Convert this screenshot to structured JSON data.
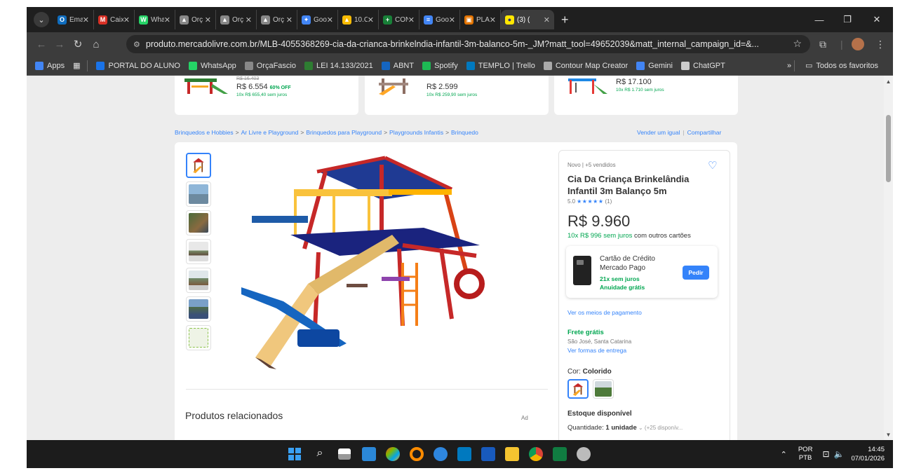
{
  "tabs": [
    {
      "label": "Ema",
      "icon": "outlook-icon",
      "color": "#0f6cbd",
      "glyph": "O"
    },
    {
      "label": "Caix",
      "icon": "gmail-icon",
      "color": "#d93025",
      "glyph": "M"
    },
    {
      "label": "Wha",
      "icon": "whatsapp-icon",
      "color": "#25d366",
      "glyph": "W"
    },
    {
      "label": "Orç",
      "icon": "orcafascio-icon",
      "color": "#888888",
      "glyph": "▲"
    },
    {
      "label": "Orç",
      "icon": "orcafascio-icon",
      "color": "#888888",
      "glyph": "▲"
    },
    {
      "label": "Orç",
      "icon": "orcafascio-icon",
      "color": "#888888",
      "glyph": "▲"
    },
    {
      "label": "Goo",
      "icon": "gemini-icon",
      "color": "#4285f4",
      "glyph": "✦"
    },
    {
      "label": "10.C",
      "icon": "drive-icon",
      "color": "#fbbc04",
      "glyph": "▲"
    },
    {
      "label": "CON",
      "icon": "sheets-icon",
      "color": "#188038",
      "glyph": "+"
    },
    {
      "label": "Goo",
      "icon": "docs-icon",
      "color": "#4285f4",
      "glyph": "≡"
    },
    {
      "label": "PLA",
      "icon": "calendar-icon",
      "color": "#e37400",
      "glyph": "▣"
    }
  ],
  "active_tab": {
    "label": "(3) (",
    "icon": "mercadolivre-icon",
    "color": "#ffe600"
  },
  "address": {
    "url": "produto.mercadolivre.com.br/MLB-4055368269-cia-da-crianca-brinkelndia-infantil-3m-balanco-5m-_JM?matt_tool=49652039&matt_internal_campaign_id=&..."
  },
  "bookmarks": [
    {
      "label": "Apps",
      "icon": "apps-grid-icon",
      "color": "#4285f4"
    },
    {
      "label": "PORTAL DO ALUNO",
      "icon": "portal-icon",
      "color": "#1a73e8"
    },
    {
      "label": "WhatsApp",
      "icon": "whatsapp-icon",
      "color": "#25d366"
    },
    {
      "label": "OrçaFascio",
      "icon": "orcafascio-icon",
      "color": "#888888"
    },
    {
      "label": "LEI 14.133/2021",
      "icon": "law-icon",
      "color": "#2e7d32"
    },
    {
      "label": "ABNT",
      "icon": "abnt-icon",
      "color": "#1565c0"
    },
    {
      "label": "Spotify",
      "icon": "spotify-icon",
      "color": "#1db954"
    },
    {
      "label": "TEMPLO | Trello",
      "icon": "trello-icon",
      "color": "#0079bf"
    },
    {
      "label": "Contour Map Creator",
      "icon": "contour-icon",
      "color": "#aaaaaa"
    },
    {
      "label": "Gemini",
      "icon": "gemini-icon",
      "color": "#4285f4"
    },
    {
      "label": "ChatGPT",
      "icon": "chatgpt-icon",
      "color": "#cccccc"
    }
  ],
  "bookmarks_more": "»",
  "all_bookmarks": "Todos os favoritos",
  "recos": [
    {
      "old": "R$ 16.403",
      "price": "R$ 6.554",
      "off": "60% OFF",
      "inst": "10x R$ 655,40 sem juros"
    },
    {
      "old": "",
      "price": "R$ 2.599",
      "off": "",
      "inst": "10x R$ 259,90 sem juros"
    },
    {
      "old": "",
      "price": "R$ 17.100",
      "off": "",
      "inst": "10x R$ 1.710 sem juros"
    }
  ],
  "breadcrumb": [
    "Brinquedos e Hobbies",
    "Ar Livre e Playground",
    "Brinquedos para Playground",
    "Playgrounds Infantis",
    "Brinquedo"
  ],
  "breadcrumb_sep": ">",
  "sell_link": "Vender um igual",
  "share_link": "Compartilhar",
  "product": {
    "condition": "Novo  |  +5 vendidos",
    "title": "Cia Da Criança Brinkelândia Infantil 3m Balanço 5m",
    "rating": "5.0",
    "stars": "★★★★★",
    "reviews": "(1)",
    "price": "R$ 9.960",
    "installments": "10x R$ 996 sem juros",
    "installments_rest": " com outros cartões",
    "card_title": "Cartão de Crédito Mercado Pago",
    "card_offer1": "21x sem juros",
    "card_offer2": "Anuidade grátis",
    "card_button": "Pedir",
    "payment_link": "Ver os meios de pagamento",
    "shipping": "Frete grátis",
    "location": "São José, Santa Catarina",
    "delivery_link": "Ver formas de entrega",
    "color_label": "Cor: ",
    "color_value": "Colorido",
    "stock": "Estoque disponível",
    "qty_label": "Quantidade: ",
    "qty_value": "1 unidade",
    "qty_more": " (+25 disponív..."
  },
  "related_title": "Produtos relacionados",
  "ad_label": "Ad",
  "taskbar": {
    "lang1": "POR",
    "lang2": "PTB",
    "time": "14:45",
    "date": "07/01/2026"
  }
}
